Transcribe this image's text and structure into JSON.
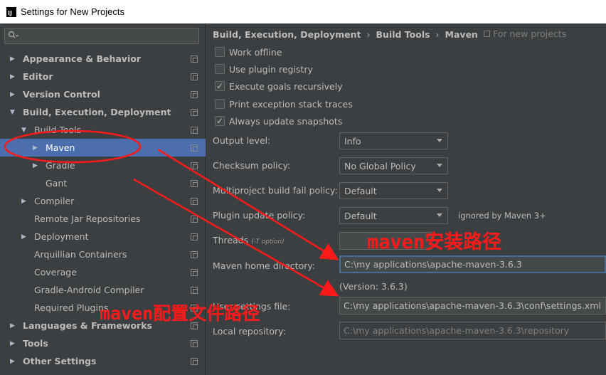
{
  "window": {
    "title": "Settings for New Projects",
    "app_icon_text": "IJ"
  },
  "search": {
    "placeholder": ""
  },
  "tree": [
    {
      "label": "Appearance & Behavior",
      "bold": true,
      "arrow": "▶",
      "indent": 0
    },
    {
      "label": "Editor",
      "bold": true,
      "arrow": "▶",
      "indent": 0
    },
    {
      "label": "Version Control",
      "bold": true,
      "arrow": "▶",
      "indent": 0
    },
    {
      "label": "Build, Execution, Deployment",
      "bold": true,
      "arrow": "▼",
      "indent": 0
    },
    {
      "label": "Build Tools",
      "bold": false,
      "arrow": "▼",
      "indent": 1
    },
    {
      "label": "Maven",
      "bold": false,
      "arrow": "▶",
      "indent": 2,
      "selected": true
    },
    {
      "label": "Gradle",
      "bold": false,
      "arrow": "▶",
      "indent": 2
    },
    {
      "label": "Gant",
      "bold": false,
      "arrow": "",
      "indent": 2
    },
    {
      "label": "Compiler",
      "bold": false,
      "arrow": "▶",
      "indent": 1
    },
    {
      "label": "Remote Jar Repositories",
      "bold": false,
      "arrow": "",
      "indent": 1
    },
    {
      "label": "Deployment",
      "bold": false,
      "arrow": "▶",
      "indent": 1
    },
    {
      "label": "Arquillian Containers",
      "bold": false,
      "arrow": "",
      "indent": 1
    },
    {
      "label": "Coverage",
      "bold": false,
      "arrow": "",
      "indent": 1
    },
    {
      "label": "Gradle-Android Compiler",
      "bold": false,
      "arrow": "",
      "indent": 1
    },
    {
      "label": "Required Plugins",
      "bold": false,
      "arrow": "",
      "indent": 1
    },
    {
      "label": "Languages & Frameworks",
      "bold": true,
      "arrow": "▶",
      "indent": 0
    },
    {
      "label": "Tools",
      "bold": true,
      "arrow": "▶",
      "indent": 0
    },
    {
      "label": "Other Settings",
      "bold": true,
      "arrow": "▶",
      "indent": 0
    }
  ],
  "breadcrumb": [
    "Build, Execution, Deployment",
    "Build Tools",
    "Maven"
  ],
  "breadcrumb_sep": "›",
  "for_new_projects": "For new projects",
  "checkboxes": [
    {
      "label": "Work offline",
      "checked": false
    },
    {
      "label": "Use plugin registry",
      "checked": false
    },
    {
      "label": "Execute goals recursively",
      "checked": true
    },
    {
      "label": "Print exception stack traces",
      "checked": false
    },
    {
      "label": "Always update snapshots",
      "checked": true
    }
  ],
  "check_mark": "✓",
  "fields": {
    "output_level": {
      "label": "Output level:",
      "value": "Info"
    },
    "checksum_policy": {
      "label": "Checksum policy:",
      "value": "No Global Policy"
    },
    "multiproject_policy": {
      "label": "Multiproject build fail policy:",
      "value": "Default"
    },
    "plugin_update_policy": {
      "label": "Plugin update policy:",
      "value": "Default",
      "note": "ignored by Maven 3+"
    },
    "threads": {
      "label": "Threads",
      "hint": "(-T option)",
      "value": ""
    },
    "maven_home": {
      "label": "Maven home directory:",
      "value": "C:\\my applications\\apache-maven-3.6.3"
    },
    "version": "(Version: 3.6.3)",
    "user_settings": {
      "label": "User settings file:",
      "value": "C:\\my applications\\apache-maven-3.6.3\\conf\\settings.xml"
    },
    "local_repo": {
      "label": "Local repository:",
      "value": "C:\\my applications\\apache-maven-3.6.3\\repository"
    }
  },
  "annotations": {
    "maven_path": "maven安装路径",
    "settings_path": "maven配置文件路径",
    "color": "#ff1a1a"
  },
  "colors": {
    "selection": "#4b6eaf",
    "background": "#3c3f41"
  }
}
